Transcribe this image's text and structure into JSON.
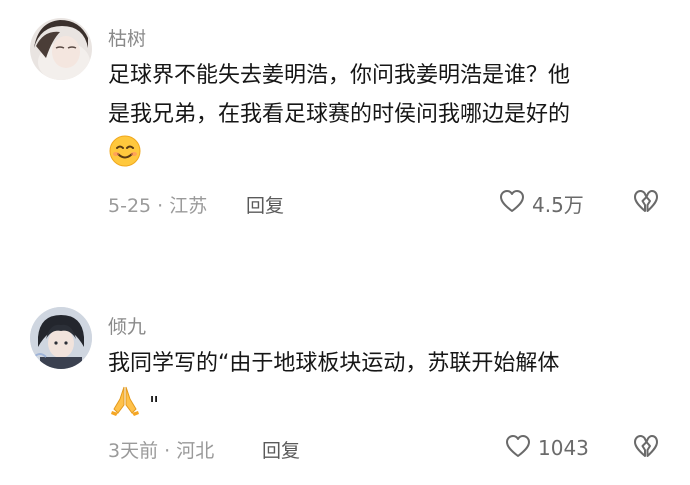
{
  "comments": [
    {
      "username": "枯树",
      "text_lines": [
        "足球界不能失去姜明浩，你问我姜明浩是谁？他",
        "是我兄弟，在我看足球赛的时侯问我哪边是好的"
      ],
      "emoji": "smiling-face-emoji",
      "meta": "5-25 · 江苏",
      "reply_label": "回复",
      "like_count": "4.5万"
    },
    {
      "username": "倾九",
      "text_lines": [
        "我同学写的“由于地球板块运动，苏联开始解体"
      ],
      "emoji": "folded-hands-emoji",
      "text_tail": "\"",
      "meta": "3天前 · 河北",
      "reply_label": "回复",
      "like_count": "1043"
    }
  ],
  "icons": {
    "like": "heart-outline-icon",
    "dislike": "broken-heart-icon"
  },
  "colors": {
    "text": "#161616",
    "username": "#8a8a8a",
    "meta": "#9a9a9a",
    "icon": "#6a6a6a"
  }
}
